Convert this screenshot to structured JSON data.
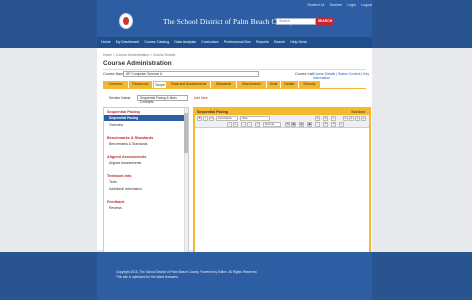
{
  "header": {
    "utility_links": [
      "Student Lit",
      "Teacher",
      "Login",
      "Logout"
    ],
    "site_title": "The School District of Palm Beach County",
    "search_placeholder": "Search",
    "search_button": "SEARCH"
  },
  "nav": {
    "items": [
      "Home",
      "My Dashboard",
      "Course Catalog",
      "Data Analysis",
      "Curriculum",
      "Professional Dev",
      "Reports",
      "Search",
      "Help Desk"
    ]
  },
  "main": {
    "breadcrumb": "Home > Course Administration > Course Details",
    "heading": "Course Administration",
    "course_name_label": "Course Name:",
    "course_name_value": "AP Computer Science A",
    "course_list_label": "Course List:",
    "course_list_options": [
      "Course Details",
      "Status Content",
      "Key Information"
    ],
    "tabs": [
      "Overview",
      "Resources",
      "Scope",
      "Tests and Assessments",
      "Standards",
      "Attachments",
      "Units",
      "Details",
      "Security"
    ],
    "active_tab": "Scope",
    "section_label": "Section Name:",
    "section_value": "Sequential Pacing & Main Concepts",
    "section_link": "Add New",
    "left_panel": [
      {
        "group": "Sequential Pacing",
        "items": [
          "Sequential Pacing",
          "Overview"
        ]
      },
      {
        "group": "Benchmarks & Standards",
        "items": [
          "Benchmarks & Standards"
        ]
      },
      {
        "group": "Aligned Assessments",
        "items": [
          "Aligned Assessments"
        ]
      },
      {
        "group": "Textbook Info",
        "items": [
          "Texts",
          "Additional Information"
        ]
      },
      {
        "group": "Feedback",
        "items": [
          "Reviews"
        ]
      }
    ],
    "selected_item": "Sequential Pacing",
    "editor_title": "Sequential Pacing",
    "editor_mode": "Standard",
    "toolbar": {
      "font_name": "Font Name",
      "font_size": "Size",
      "font_format": "Normal",
      "buttons": [
        "B",
        "I",
        "U",
        "A",
        "S",
        "x",
        "x",
        "≡",
        "≡",
        "≡",
        "≡",
        "•",
        "1.",
        "←",
        "→",
        "↗",
        "⚙",
        "▦",
        "▤",
        "▣",
        "↓",
        "↶",
        "↷",
        "✂",
        "⎘",
        "☰",
        "⚡",
        "✔"
      ]
    },
    "save_label": "SAVE",
    "cancel_label": "CANCEL"
  },
  "footer": {
    "copyright": "Copyright 2015, The School District of Palm Beach County. Powered by Edline. All Rights Reserved.",
    "note": "This site is optimized for the latest browsers."
  },
  "colors": {
    "brand_blue": "#2d5ea3",
    "dark_blue": "#1f4e8c",
    "accent_red": "#c7262f",
    "tab_yellow": "#f5b82e"
  }
}
